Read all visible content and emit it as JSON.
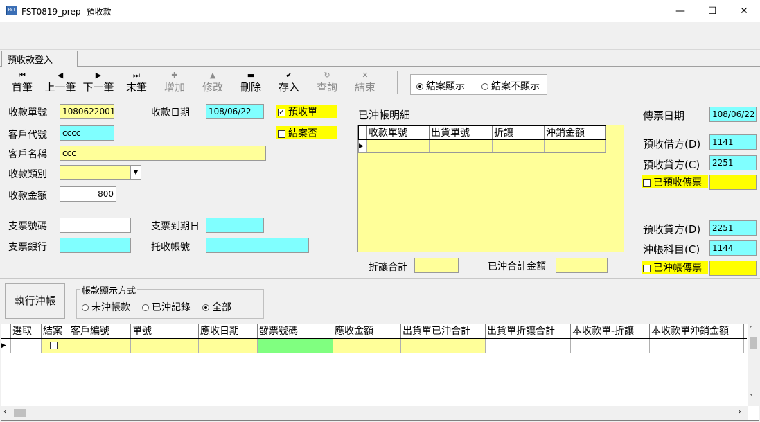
{
  "window": {
    "title": "FST0819_prep  -預收款",
    "icon_name": "app-icon",
    "minimize": "—",
    "maximize": "☐",
    "close": "✕"
  },
  "tab": {
    "label": "預收款登入"
  },
  "toolbar": {
    "buttons": [
      {
        "icon": "first-icon",
        "glyph": "⏮",
        "label": "首筆",
        "enabled": true
      },
      {
        "icon": "prev-icon",
        "glyph": "◀",
        "label": "上一筆",
        "enabled": true
      },
      {
        "icon": "next-icon",
        "glyph": "▶",
        "label": "下一筆",
        "enabled": true
      },
      {
        "icon": "last-icon",
        "glyph": "⏭",
        "label": "末筆",
        "enabled": true
      },
      {
        "icon": "add-icon",
        "glyph": "✚",
        "label": "增加",
        "enabled": false
      },
      {
        "icon": "edit-icon",
        "glyph": "▲",
        "label": "修改",
        "enabled": false
      },
      {
        "icon": "delete-icon",
        "glyph": "▬",
        "label": "刪除",
        "enabled": true
      },
      {
        "icon": "save-icon",
        "glyph": "✔",
        "label": "存入",
        "enabled": true
      },
      {
        "icon": "query-icon",
        "glyph": "↻",
        "label": "查詢",
        "enabled": false
      },
      {
        "icon": "close-icon",
        "glyph": "✕",
        "label": "結束",
        "enabled": false
      }
    ],
    "display_options": {
      "closed_show": "結案顯示",
      "closed_hide": "結案不顯示",
      "selected": "closed_show"
    }
  },
  "form": {
    "receipt_no_label": "收款單號",
    "receipt_no": "1080622001",
    "receipt_date_label": "收款日期",
    "receipt_date": "108/06/22",
    "prepay_label": "預收單",
    "prepay_checked": true,
    "closed_label": "結案否",
    "closed_checked": false,
    "customer_code_label": "客戶代號",
    "customer_code": "cccc",
    "customer_name_label": "客戶名稱",
    "customer_name": "ccc",
    "receipt_type_label": "收款類別",
    "receipt_type": "",
    "amount_label": "收款金額",
    "amount": "800",
    "check_no_label": "支票號碼",
    "check_no": "",
    "check_due_label": "支票到期日",
    "check_due": "",
    "check_bank_label": "支票銀行",
    "check_bank": "",
    "collect_account_label": "托收帳號",
    "collect_account": ""
  },
  "offset_detail": {
    "title": "已沖帳明細",
    "columns": [
      "收款單號",
      "出貨單號",
      "折讓",
      "沖銷金額"
    ],
    "discount_total_label": "折讓合計",
    "discount_total": "",
    "offset_total_label": "已沖合計金額",
    "offset_total": ""
  },
  "voucher": {
    "date_label": "傳票日期",
    "date": "108/06/22",
    "prepay_debit_label": "預收借方(D)",
    "prepay_debit": "1141",
    "prepay_credit_label": "預收貸方(C)",
    "prepay_credit": "2251",
    "prepay_voucher_label": "已預收傳票",
    "prepay_voucher": "",
    "prepay_credit2_label": "預收貸方(D)",
    "prepay_credit2": "2251",
    "offset_account_label": "沖帳科目(C)",
    "offset_account": "1144",
    "offset_voucher_label": "已沖帳傳票",
    "offset_voucher": ""
  },
  "actions": {
    "execute_offset": "執行沖帳",
    "display_mode_title": "帳款顯示方式",
    "mode_unoffset": "未沖帳款",
    "mode_offset": "已沖記錄",
    "mode_all": "全部",
    "selected": "mode_all"
  },
  "grid": {
    "columns": [
      "選取",
      "結案",
      "客戶編號",
      "單號",
      "應收日期",
      "發票號碼",
      "應收金額",
      "出貨單已沖合計",
      "出貨單折讓合計",
      "本收款單-折讓",
      "本收款單沖銷金額"
    ]
  },
  "colors": {
    "yellow_field": "#ffff99",
    "cyan_field": "#80ffff",
    "highlight_label": "#ffff00",
    "invoice_cell": "#80ff80"
  }
}
